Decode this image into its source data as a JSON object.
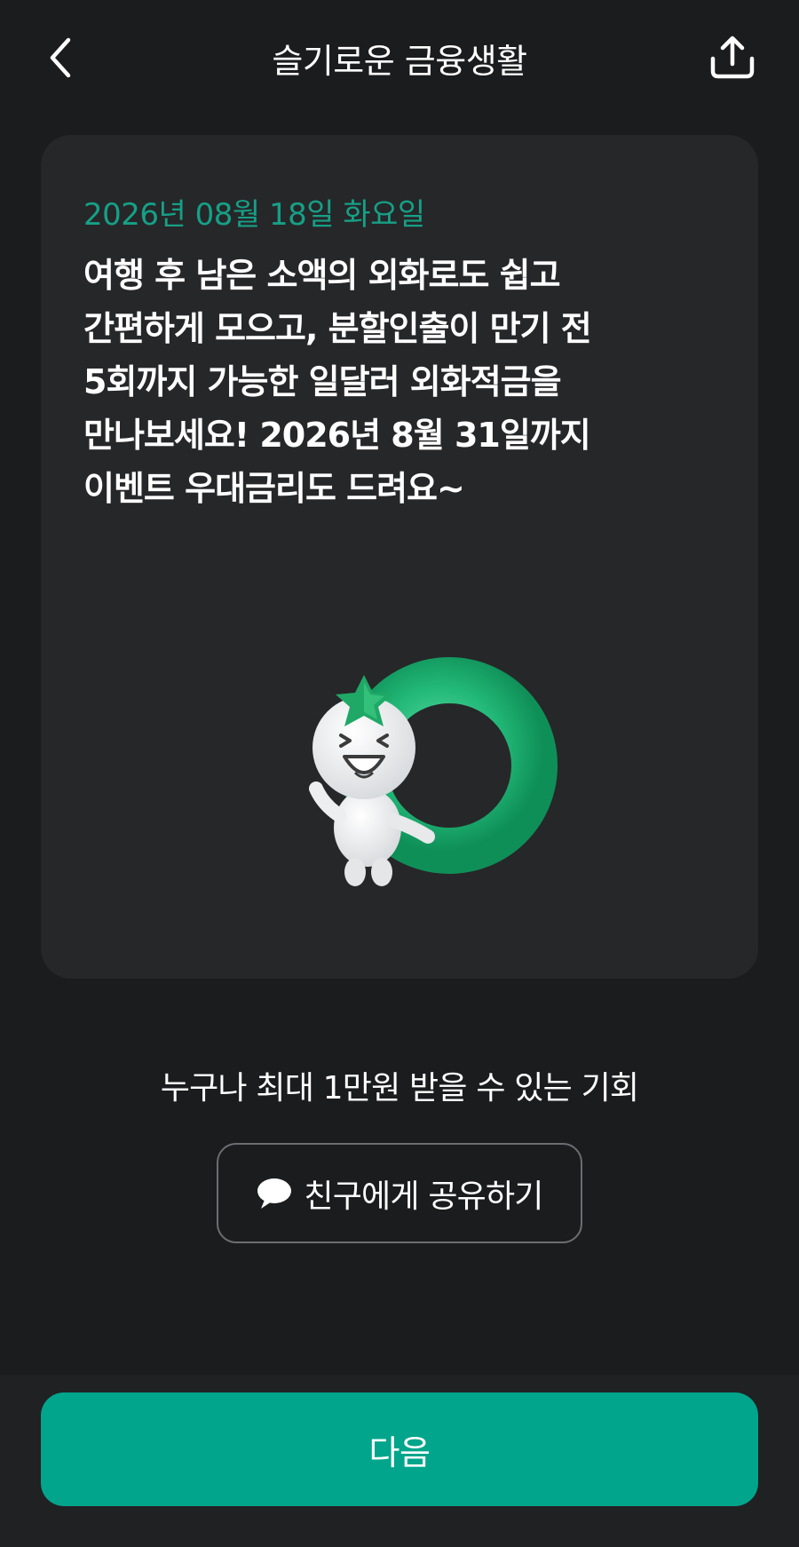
{
  "header": {
    "title": "슬기로운 금융생활",
    "back_icon": "chevron-left-icon",
    "share_icon": "share-upload-icon"
  },
  "card": {
    "date": "2026년 08월 18일 화요일",
    "message": "여행 후 남은 소액의 외화로도 쉽고\n간편하게 모으고, 분할인출이 만기 전\n5회까지 가능한 일달러 외화적금을\n만나보세요! 2026년 8월 31일까지\n이벤트 우대금리도 드려요~",
    "mascot": "mascot-with-ring-illustration"
  },
  "promo": {
    "text": "누구나 최대 1만원 받을 수 있는 기회"
  },
  "share_friend": {
    "label": "친구에게 공유하기",
    "icon": "speech-bubble-icon"
  },
  "footer": {
    "next_label": "다음"
  },
  "colors": {
    "background": "#1b1c1e",
    "card": "#262729",
    "accent": "#00a58c",
    "date_text": "#16a086",
    "ring_green": "#2fc98a"
  }
}
